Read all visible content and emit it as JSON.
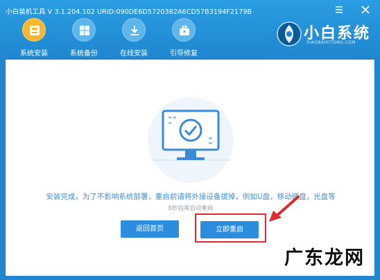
{
  "titlebar": {
    "title": "小白装机工具 V 3.1.204.102 URID:090DE6D5720382A6CD57B3194F2179B"
  },
  "nav": {
    "items": [
      {
        "label": "系统安装",
        "icon": "disk-install-icon",
        "active": true
      },
      {
        "label": "系统备份",
        "icon": "windows-backup-icon",
        "active": false
      },
      {
        "label": "在线安装",
        "icon": "download-icon",
        "active": false
      },
      {
        "label": "引导修复",
        "icon": "toolbox-icon",
        "active": false
      }
    ]
  },
  "logo": {
    "name": "小白系统",
    "sub": "XIAOBAIXITONG.COM"
  },
  "main": {
    "message": "安装完成，为了不影响系统部署，重启前请将外接设备拔掉，例如U盘，移动硬盘，光盘等",
    "countdown": "8秒后将自动重启",
    "back_label": "返回首页",
    "restart_label": "立即重启"
  },
  "watermark": "广东龙网",
  "colors": {
    "header": "#1f86cf",
    "active_icon": "#f5b731",
    "button": "#2c8ddf",
    "highlight": "#e0282e"
  }
}
